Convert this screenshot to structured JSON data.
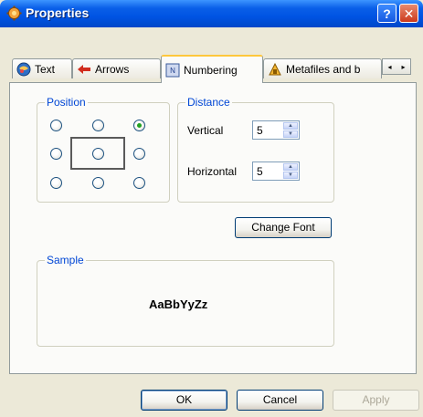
{
  "window": {
    "title": "Properties",
    "help_glyph": "?",
    "close_glyph": "✕"
  },
  "tabs": [
    {
      "label": "Text",
      "icon": "text-globe-icon"
    },
    {
      "label": "Arrows",
      "icon": "red-arrow-icon"
    },
    {
      "label": "Numbering",
      "icon": "numbering-icon",
      "active": true
    },
    {
      "label": "Metafiles and b",
      "icon": "metafile-icon"
    }
  ],
  "tab_scroll": {
    "left": "◂",
    "right": "▸"
  },
  "position": {
    "label": "Position",
    "grid_selected": "top-right"
  },
  "distance": {
    "label": "Distance",
    "vertical_label": "Vertical",
    "vertical_value": "5",
    "horizontal_label": "Horizontal",
    "horizontal_value": "5"
  },
  "buttons": {
    "change_font": "Change Font",
    "ok": "OK",
    "cancel": "Cancel",
    "apply": "Apply"
  },
  "sample": {
    "label": "Sample",
    "text": "AaBbYyZz"
  },
  "colors": {
    "title_bar": "#0054e3",
    "group_label": "#0046d5",
    "active_tab_accent": "#ffc73c"
  }
}
